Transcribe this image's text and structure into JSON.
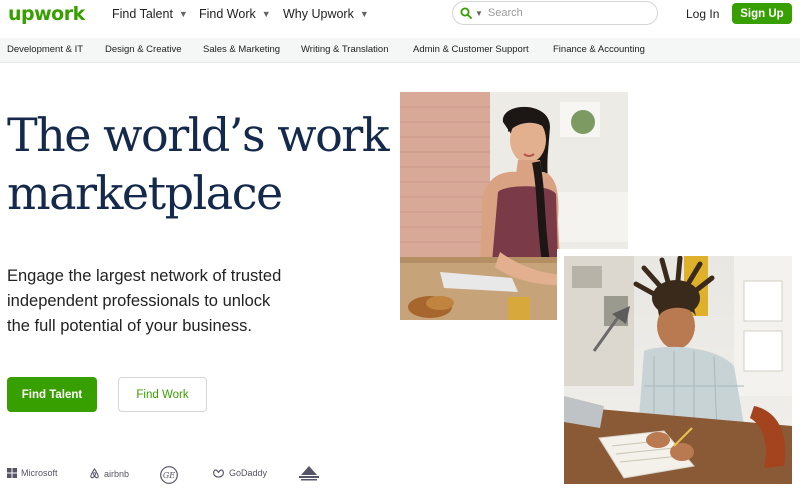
{
  "header": {
    "logo": "upwork",
    "nav": [
      {
        "label": "Find Talent"
      },
      {
        "label": "Find Work"
      },
      {
        "label": "Why Upwork"
      }
    ],
    "search": {
      "placeholder": "Search"
    },
    "login_label": "Log In",
    "signup_label": "Sign Up"
  },
  "categories": [
    "Development & IT",
    "Design & Creative",
    "Sales & Marketing",
    "Writing & Translation",
    "Admin & Customer Support",
    "Finance & Accounting"
  ],
  "hero": {
    "title_line1": "The world’s work",
    "title_line2": "marketplace",
    "subtitle_line1": "Engage the largest network of trusted",
    "subtitle_line2": "independent professionals to unlock",
    "subtitle_line3": "the full potential of your business.",
    "find_talent_label": "Find Talent",
    "find_work_label": "Find Work"
  },
  "trusted_logos": [
    {
      "name": "Microsoft",
      "icon": "microsoft-logo"
    },
    {
      "name": "airbnb",
      "icon": "airbnb-logo"
    },
    {
      "name": "GE",
      "icon": "ge-logo"
    },
    {
      "name": "GoDaddy",
      "icon": "godaddy-logo"
    },
    {
      "name": "",
      "icon": "automattic-logo"
    }
  ],
  "colors": {
    "brand_green": "#37a000",
    "headline_navy": "#14294b",
    "category_bar_bg": "#f5f6f6"
  }
}
